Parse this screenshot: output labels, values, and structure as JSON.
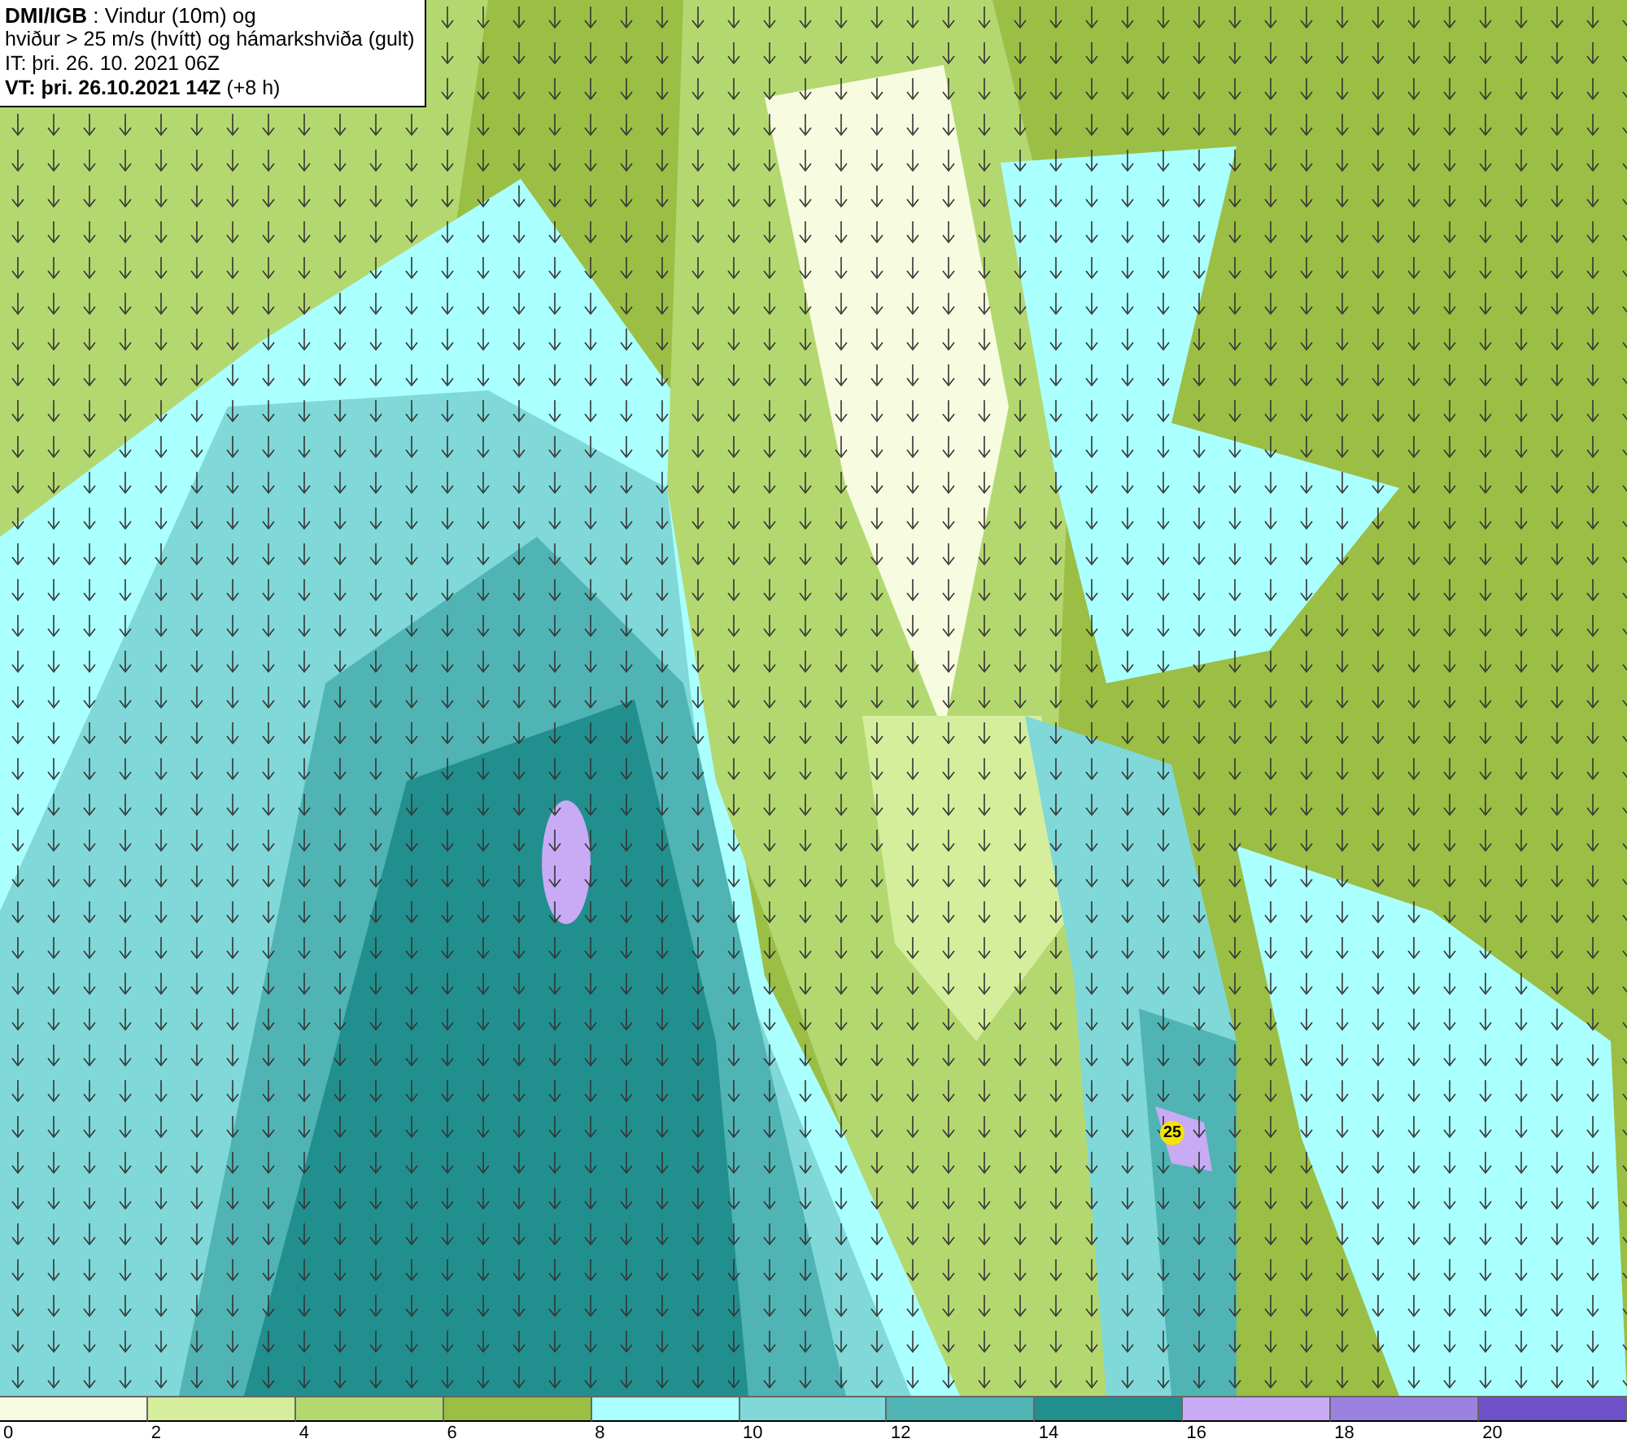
{
  "title_box": {
    "lines": [
      "**DMI/IGB** : Vindur (10m) og",
      "hviður > 25 m/s (hvítt) og hámarkshviða (gult)",
      "IT: þri. 26. 10. 2021 06Z",
      "**VT: þri. 26.10.2021 14Z** (+8 h)"
    ]
  },
  "gust_markers": [
    {
      "value": "25"
    }
  ],
  "legend": {
    "bins": [
      {
        "color": "#f7fbe0"
      },
      {
        "color": "#d4ee9c"
      },
      {
        "color": "#b4d870"
      },
      {
        "color": "#9bbe45"
      },
      {
        "color": "#aaffff"
      },
      {
        "color": "#80d8d8"
      },
      {
        "color": "#50b4b4"
      },
      {
        "color": "#228f8f"
      },
      {
        "color": "#c8aaf5"
      },
      {
        "color": "#9b82e0"
      },
      {
        "color": "#6e50c8"
      }
    ],
    "ticks": [
      "0",
      "2",
      "4",
      "6",
      "8",
      "10",
      "12",
      "14",
      "16",
      "18",
      "20"
    ]
  }
}
